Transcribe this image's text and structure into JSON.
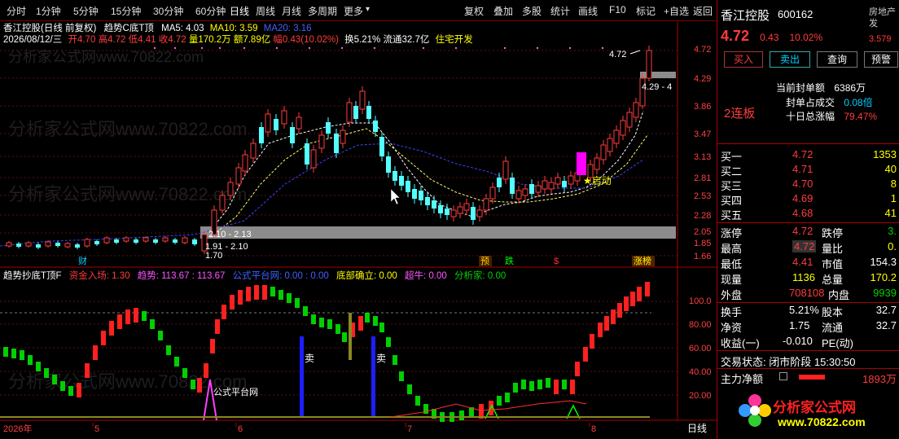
{
  "toolbar": {
    "left_items": [
      "分时",
      "1分钟",
      "5分钟",
      "15分钟",
      "30分钟",
      "60分钟",
      "日线",
      "周线",
      "月线",
      "多周期",
      "更多"
    ],
    "right_items": [
      "复权",
      "叠加",
      "多股",
      "统计",
      "画线",
      "F10",
      "标记",
      "+自选",
      "返回"
    ]
  },
  "chart": {
    "title": "香江控股(日线 前复权)",
    "indicator_name": "趋势C底T顶",
    "ma5": "MA5: 4.03",
    "ma10": "MA10: 3.59",
    "ma20": "MA20: 3.16",
    "date": "2026/08/12/三",
    "open": "开4.70",
    "high": "高4.72",
    "low": "低4.41",
    "close": "收4.72",
    "volume": "量170.2万",
    "amount": "额7.89亿",
    "change": "幅0.43(10.02%)",
    "turnover": "换5.21%",
    "float": "流通32.7亿",
    "sector": "住宅开发",
    "watermark_top": "分析家公式网www.70822.com",
    "price_axis": [
      "4.72",
      "4.29",
      "3.86",
      "3.47",
      "3.13",
      "2.81",
      "2.53",
      "2.28",
      "2.05",
      "1.85",
      "1.66"
    ],
    "label_high": "4.72",
    "label_range_high": "4.29 - 4",
    "label_range_low": "2.10 - 2.13",
    "label_range_low2": "1.91 - 2.10",
    "label_min": "1.70",
    "label_qidong": "★启动",
    "event_labels": [
      "财",
      "预",
      "跌",
      "$",
      "涨榜"
    ]
  },
  "sub_chart": {
    "title": "趋势抄底T顶F",
    "zijin": "资金入场: 1.30",
    "qushi": "趋势: 113.67 : 113.67",
    "gongshi": "公式平台网: 0.00 : 0.00",
    "dibu": "底部确立: 0.00",
    "chaoniu": "超牛: 0.00",
    "fenxijia": "分析家: 0.00",
    "axis": [
      "100.0",
      "80.00",
      "60.00",
      "40.00",
      "20.00"
    ],
    "sell_label": "卖",
    "platform_label": "公式平台网"
  },
  "timeline": {
    "labels": [
      "2026年",
      "5",
      "6",
      "7",
      "8"
    ],
    "period": "日线"
  },
  "panel": {
    "name": "香江控股",
    "code": "600162",
    "category": "房地产发",
    "price": "4.72",
    "change": "0.43",
    "pct": "10.02%",
    "cat_price": "3.579",
    "buttons": [
      "买入",
      "卖出",
      "查询",
      "预警"
    ],
    "seal_label": "当前封单额",
    "seal_value": "6386万",
    "seal_ratio_label": "封单占成交",
    "seal_ratio_value": "0.08倍",
    "ten_day_label": "十日总涨幅",
    "ten_day_value": "79.47%",
    "streak": "2连板",
    "bids": [
      {
        "label": "买一",
        "price": "4.72",
        "vol": "1353"
      },
      {
        "label": "买二",
        "price": "4.71",
        "vol": "40"
      },
      {
        "label": "买三",
        "price": "4.70",
        "vol": "8"
      },
      {
        "label": "买四",
        "price": "4.69",
        "vol": "1"
      },
      {
        "label": "买五",
        "price": "4.68",
        "vol": "41"
      }
    ],
    "stats": [
      {
        "l1": "涨停",
        "v1": "4.72",
        "l2": "跌停",
        "v2": "3."
      },
      {
        "l1": "最高",
        "v1": "4.72",
        "l2": "量比",
        "v2": "0."
      },
      {
        "l1": "最低",
        "v1": "4.41",
        "l2": "市值",
        "v2": "154.3"
      },
      {
        "l1": "现量",
        "v1": "1136",
        "l2": "总量",
        "v2": "170.2"
      },
      {
        "l1": "外盘",
        "v1": "708108",
        "l2": "内盘",
        "v2": "9939"
      }
    ],
    "stats2": [
      {
        "l1": "换手",
        "v1": "5.21%",
        "l2": "股本",
        "v2": "32.7"
      },
      {
        "l1": "净资",
        "v1": "1.75",
        "l2": "流通",
        "v2": "32.7"
      },
      {
        "l1": "收益(一)",
        "v1": "-0.010",
        "l2": "PE(动)",
        "v2": ""
      }
    ],
    "trade_status": "交易状态: 闭市阶段 15:30:50",
    "main_net_label": "主力净额",
    "main_net_value": "1893万",
    "logo_text": "分析家公式网",
    "logo_url": "www.70822.com"
  }
}
